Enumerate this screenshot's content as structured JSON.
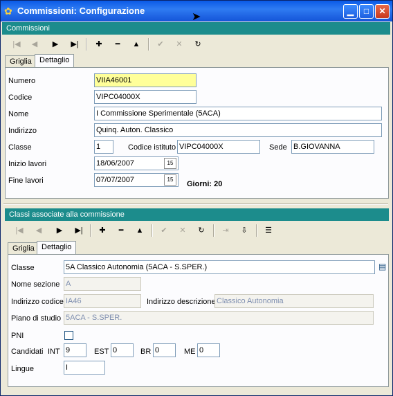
{
  "window": {
    "title": "Commissioni: Configurazione",
    "min": "▁",
    "max": "□",
    "close": "✕"
  },
  "top": {
    "header": "Commissioni",
    "toolbar": {
      "first": "|◀",
      "prev": "◀",
      "next": "▶",
      "last": "▶|",
      "add": "✚",
      "del": "━",
      "up": "▲",
      "ok": "✔",
      "cancel": "✕",
      "refresh": "↻"
    },
    "tabs": [
      "Griglia",
      "Dettaglio"
    ],
    "form": {
      "numero_label": "Numero",
      "numero": "VIIA46001",
      "codice_label": "Codice",
      "codice": "VIPC04000X",
      "nome_label": "Nome",
      "nome": "I Commissione Sperimentale (5ACA)",
      "indirizzo_label": "Indirizzo",
      "indirizzo": "Quinq. Auton. Classico",
      "classe_label": "Classe",
      "classe": "1",
      "codice_istituto_label": "Codice istituto",
      "codice_istituto": "VIPC04000X",
      "sede_label": "Sede",
      "sede": "B.GIOVANNA",
      "inizio_label": "Inizio lavori",
      "inizio": "18/06/2007",
      "fine_label": "Fine lavori",
      "fine": "07/07/2007",
      "giorni": "Giorni: 20",
      "cal": "15"
    }
  },
  "bottom": {
    "header": "Classi associate alla commissione",
    "toolbar": {
      "first": "|◀",
      "prev": "◀",
      "next": "▶",
      "last": "▶|",
      "add": "✚",
      "del": "━",
      "up": "▲",
      "ok": "✔",
      "cancel": "✕",
      "refresh": "↻",
      "import": "⇥",
      "sort": "⇩",
      "list": "☰"
    },
    "tabs": [
      "Griglia",
      "Dettaglio"
    ],
    "form": {
      "classe_label": "Classe",
      "classe": "5A Classico Autonomia (5ACA - S.SPER.)",
      "nome_sezione_label": "Nome sezione",
      "nome_sezione": "A",
      "indirizzo_codice_label": "Indirizzo codice",
      "indirizzo_codice": "IA46",
      "indirizzo_descrizione_label": "Indirizzo descrizione",
      "indirizzo_descrizione": "Classico Autonomia",
      "piano_label": "Piano di studio",
      "piano": "5ACA - S.SPER.",
      "pni_label": "PNI",
      "candidati_label": "Candidati",
      "int_label": "INT",
      "int": "9",
      "est_label": "EST",
      "est": "0",
      "br_label": "BR",
      "br": "0",
      "me_label": "ME",
      "me": "0",
      "lingue_label": "Lingue",
      "lingue": "I"
    }
  }
}
